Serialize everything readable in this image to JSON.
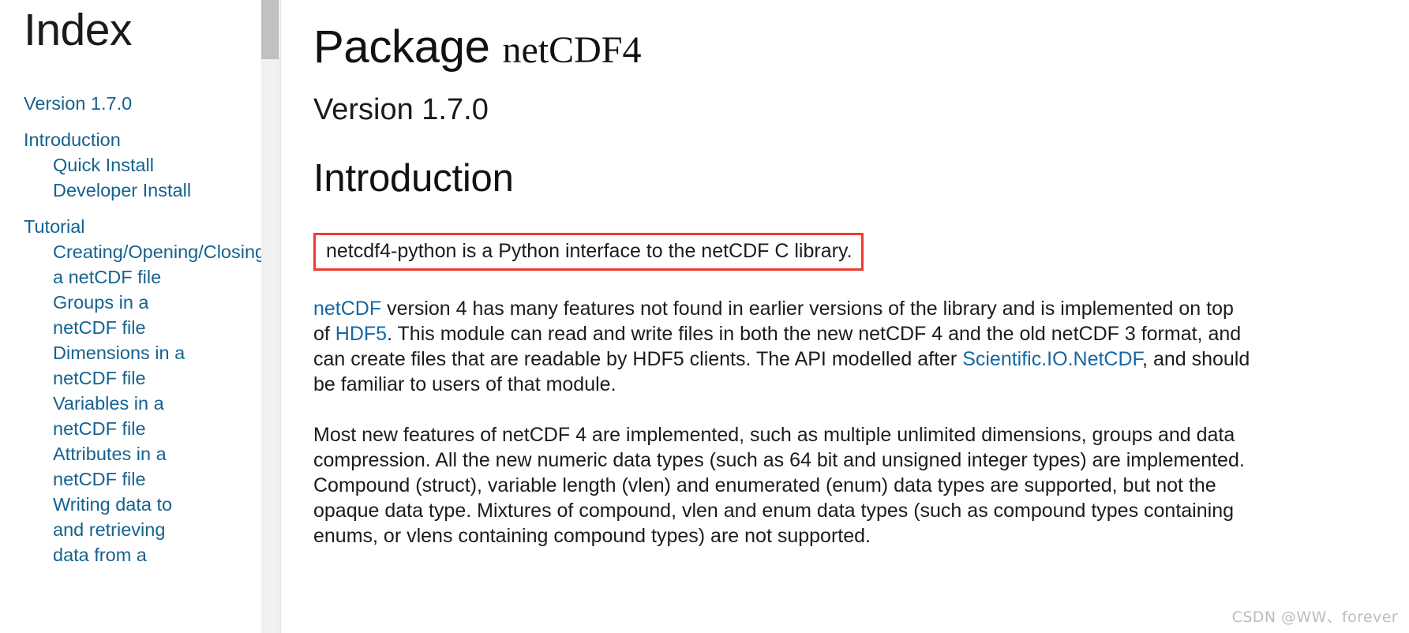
{
  "sidebar": {
    "title": "Index",
    "scrollbar": {
      "thumb_color": "#c1c1c1",
      "track_color": "#f1f1f1"
    },
    "items": [
      {
        "label": "Version 1.7.0",
        "level": 1,
        "group_start": true
      },
      {
        "label": "Introduction",
        "level": 1,
        "group_start": true
      },
      {
        "label": "Quick Install",
        "level": 2,
        "group_start": false
      },
      {
        "label": "Developer Install",
        "level": 2,
        "group_start": false
      },
      {
        "label": "Tutorial",
        "level": 1,
        "group_start": true
      },
      {
        "label": "Creating/Opening/Closing",
        "level": 2,
        "group_start": false
      },
      {
        "label": "a netCDF file",
        "level": 2,
        "group_start": false
      },
      {
        "label": "Groups in a",
        "level": 2,
        "group_start": false
      },
      {
        "label": "netCDF file",
        "level": 2,
        "group_start": false
      },
      {
        "label": "Dimensions in a",
        "level": 2,
        "group_start": false
      },
      {
        "label": "netCDF file",
        "level": 2,
        "group_start": false
      },
      {
        "label": "Variables in a",
        "level": 2,
        "group_start": false
      },
      {
        "label": "netCDF file",
        "level": 2,
        "group_start": false
      },
      {
        "label": "Attributes in a",
        "level": 2,
        "group_start": false
      },
      {
        "label": "netCDF file",
        "level": 2,
        "group_start": false
      },
      {
        "label": "Writing data to",
        "level": 2,
        "group_start": false
      },
      {
        "label": "and retrieving",
        "level": 2,
        "group_start": false
      },
      {
        "label": "data from a",
        "level": 2,
        "group_start": false
      }
    ]
  },
  "main": {
    "package_title_prefix": "Package ",
    "package_title_mono": "netCDF4",
    "version": "Version 1.7.0",
    "section_heading": "Introduction",
    "highlight": {
      "text": "netcdf4-python is a Python interface to the netCDF C library.",
      "border_color": "#ef3a32"
    },
    "paragraph2": {
      "link1": "netCDF",
      "text1": " version 4 has many features not found in earlier versions of the library and is implemented on top of ",
      "link2": "HDF5",
      "text2": ". This module can read and write files in both the new netCDF 4 and the old netCDF 3 format, and can create files that are readable by HDF5 clients. The API modelled after ",
      "link3": "Scientific.IO.NetCDF",
      "text3": ", and should be familiar to users of that module."
    },
    "paragraph3": "Most new features of netCDF 4 are implemented, such as multiple unlimited dimensions, groups and data compression. All the new numeric data types (such as 64 bit and unsigned integer types) are implemented. Compound (struct), variable length (vlen) and enumerated (enum) data types are supported, but not the opaque data type. Mixtures of compound, vlen and enum data types (such as compound types containing enums, or vlens containing compound types) are not supported.",
    "link_color": "#1567a4"
  },
  "watermark": "CSDN @WW、forever"
}
